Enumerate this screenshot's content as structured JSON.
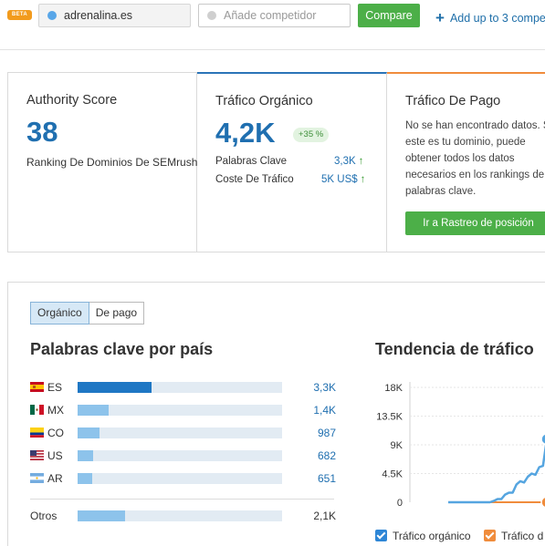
{
  "topbar": {
    "beta_label": "BETA",
    "domain_value": "adrenalina.es",
    "competitor_placeholder": "Añade competidor",
    "compare_label": "Compare",
    "add_link": "Add up to 3 compe"
  },
  "summary": {
    "authority": {
      "title": "Authority Score",
      "value": "38",
      "subtitle": "Ranking De Dominios De SEMrush"
    },
    "organic": {
      "title": "Tráfico Orgánico",
      "value": "4,2K",
      "change": "+35 %",
      "rows": [
        {
          "label": "Palabras Clave",
          "value": "3,3K"
        },
        {
          "label": "Coste De Tráfico",
          "value": "5K US$"
        }
      ]
    },
    "paid": {
      "title": "Tráfico De Pago",
      "message": "No se han encontrado datos. Si este es tu dominio, puede obtener todos los datos necesarios en los rankings de palabras clave.",
      "button": "Ir a Rastreo de posición"
    }
  },
  "lower": {
    "toggle": [
      "Orgánico",
      "De pago"
    ],
    "keywords_title": "Palabras clave por país",
    "trend_title": "Tendencia de tráfico",
    "countries": [
      {
        "code": "ES",
        "value": "3,3K",
        "share": 1.0
      },
      {
        "code": "MX",
        "value": "1,4K",
        "share": 0.42
      },
      {
        "code": "CO",
        "value": "987",
        "share": 0.3
      },
      {
        "code": "US",
        "value": "682",
        "share": 0.21
      },
      {
        "code": "AR",
        "value": "651",
        "share": 0.2
      }
    ],
    "others": {
      "label": "Otros",
      "value": "2,1K",
      "share": 0.64
    },
    "legend": [
      "Tráfico orgánico",
      "Tráfico d"
    ]
  },
  "colors": {
    "accent_blue": "#1f6fb0",
    "bar_primary": "#1f77c4",
    "bar_secondary": "#8dc3eb",
    "green": "#4caf48",
    "orange": "#f08c3c"
  },
  "chart_data": {
    "type": "line",
    "title": "Tendencia de tráfico",
    "y_ticks": [
      "18K",
      "13.5K",
      "9K",
      "4.5K",
      "0"
    ],
    "ylim": [
      0,
      18000
    ],
    "series": [
      {
        "name": "Tráfico orgánico",
        "values": [
          0,
          0,
          0,
          0,
          0,
          0,
          0,
          0,
          0,
          0,
          0,
          0,
          200,
          500,
          500,
          1200,
          1500,
          1500,
          2800,
          3300,
          3100,
          4000,
          4500,
          4300,
          5500,
          5700,
          9900
        ]
      },
      {
        "name": "Tráfico d",
        "values": [
          0,
          0,
          0,
          0,
          0,
          0,
          0,
          0,
          0,
          0,
          0,
          0,
          0,
          0,
          0,
          0,
          0,
          0,
          0,
          0,
          0,
          0,
          0,
          0,
          0,
          0,
          0
        ]
      }
    ]
  }
}
